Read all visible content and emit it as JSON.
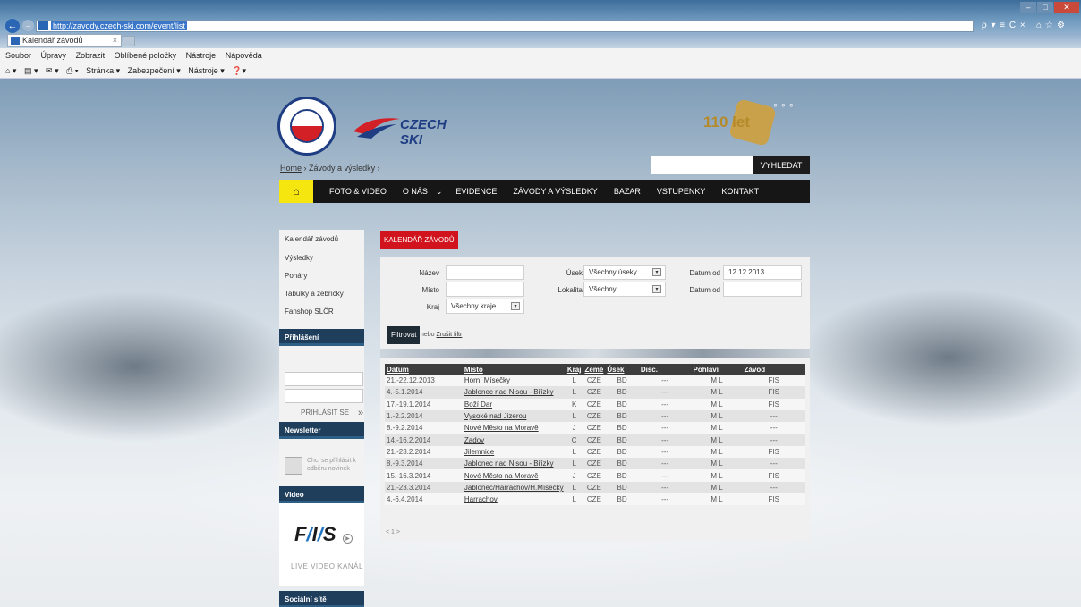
{
  "browser": {
    "url": "http://zavody.czech-ski.com/event/list",
    "tab_title": "Kalendář závodů",
    "tab_close": "×",
    "menu": [
      "Soubor",
      "Úpravy",
      "Zobrazit",
      "Oblíbené položky",
      "Nástroje",
      "Nápověda"
    ],
    "commands": [
      "Stránka ▾",
      "Zabezpečení ▾",
      "Nástroje ▾"
    ],
    "address_tools": "ρ ▾ ≡ C ×"
  },
  "header": {
    "logo_text": "CZECH SKI",
    "anniversary": "110 let",
    "breadcrumb_home": "Home",
    "breadcrumb_sep": "›",
    "breadcrumb_current": "Závody a výsledky",
    "search_button": "VYHLEDAT"
  },
  "nav": {
    "items": [
      "FOTO & VIDEO",
      "O NÁS",
      "EVIDENCE",
      "ZÁVODY A VÝSLEDKY",
      "BAZAR",
      "VSTUPENKY",
      "KONTAKT"
    ]
  },
  "sidebar": {
    "links": [
      "Kalendář závodů",
      "Výsledky",
      "Poháry",
      "Tabulky a žebříčky",
      "Fanshop SLČR"
    ],
    "login_heading": "Přihlášení",
    "login_button": "PŘIHLÁSIT SE",
    "newsletter_heading": "Newsletter",
    "newsletter_text": "Chci se přihlásit k odběru novinek",
    "video_heading": "Video",
    "video_caption": "LIVE VIDEO KANÁL",
    "social_heading": "Sociální sítě"
  },
  "content": {
    "tab_title": "KALENDÁŘ ZÁVODŮ",
    "form": {
      "nazev_label": "Název",
      "misto_label": "Místo",
      "kraj_label": "Kraj",
      "kraj_value": "Všechny kraje",
      "usek_label": "Úsek",
      "usek_value": "Všechny úseky",
      "lokalita_label": "Lokalita",
      "lokalita_value": "Všechny",
      "datum_od_label": "Datum od",
      "datum_od_value": "12.12.2013",
      "datum_do_label": "Datum od",
      "filter_button": "Filtrovat",
      "or_text": "nebo",
      "reset_link": "Zrušit filtr"
    },
    "table": {
      "headers": [
        "Datum",
        "Místo",
        "Kraj",
        "Země",
        "Úsek",
        "Disc.",
        "Pohlaví",
        "Závod"
      ],
      "rows": [
        [
          "21.-22.12.2013",
          "Horní Mísečky",
          "L",
          "CZE",
          "BD",
          "---",
          "M L",
          "FIS"
        ],
        [
          "4.-5.1.2014",
          "Jablonec nad Nisou - Břízky",
          "L",
          "CZE",
          "BD",
          "---",
          "M L",
          "FIS"
        ],
        [
          "17.-19.1.2014",
          "Boží Dar",
          "K",
          "CZE",
          "BD",
          "---",
          "M L",
          "FIS"
        ],
        [
          "1.-2.2.2014",
          "Vysoké nad Jizerou",
          "L",
          "CZE",
          "BD",
          "---",
          "M L",
          "---"
        ],
        [
          "8.-9.2.2014",
          "Nové Město na Moravě",
          "J",
          "CZE",
          "BD",
          "---",
          "M L",
          "---"
        ],
        [
          "14.-16.2.2014",
          "Zadov",
          "C",
          "CZE",
          "BD",
          "---",
          "M L",
          "---"
        ],
        [
          "21.-23.2.2014",
          "Jilemnice",
          "L",
          "CZE",
          "BD",
          "---",
          "M L",
          "FIS"
        ],
        [
          "8.-9.3.2014",
          "Jablonec nad Nisou - Břízky",
          "L",
          "CZE",
          "BD",
          "---",
          "M L",
          "---"
        ],
        [
          "15.-16.3.2014",
          "Nové Město na Moravě",
          "J",
          "CZE",
          "BD",
          "---",
          "M L",
          "FIS"
        ],
        [
          "21.-23.3.2014",
          "Jablonec/Harrachov/H.Mísečky",
          "L",
          "CZE",
          "BD",
          "---",
          "M L",
          "---"
        ],
        [
          "4.-6.4.2014",
          "Harrachov",
          "L",
          "CZE",
          "BD",
          "---",
          "M L",
          "FIS"
        ]
      ]
    },
    "pager": "< 1 >"
  },
  "colors": {
    "accent_red": "#d0131c",
    "nav_black": "#161616",
    "home_yellow": "#f5e60f",
    "sidebar_head": "#1f3e5b"
  }
}
